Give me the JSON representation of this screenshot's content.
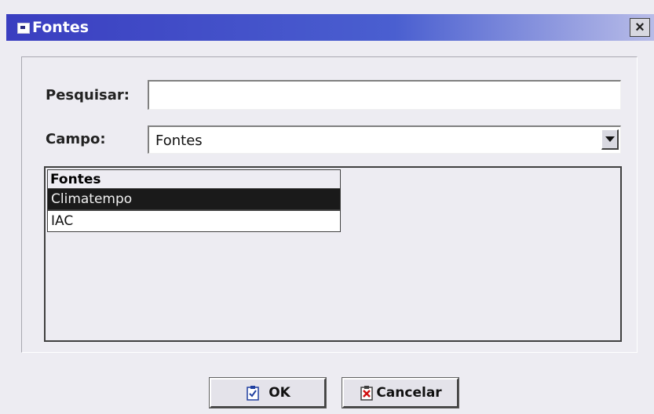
{
  "window": {
    "title": "Fontes",
    "close_label": "×"
  },
  "search": {
    "label": "Pesquisar:",
    "value": "",
    "placeholder": ""
  },
  "campo": {
    "label": "Campo:",
    "selected": "Fontes"
  },
  "list": {
    "header": "Fontes",
    "rows": [
      {
        "text": "Climatempo",
        "selected": true
      },
      {
        "text": "IAC",
        "selected": false
      }
    ]
  },
  "buttons": {
    "ok_label": "OK",
    "cancel_label": "Cancelar"
  },
  "colors": {
    "titlebar_start": "#3a3ec0",
    "titlebar_end": "#b8bce8",
    "selected_row": "#1a1a1a"
  },
  "icons": {
    "window": "window-icon",
    "ok": "clipboard-check-icon",
    "cancel": "clipboard-x-icon"
  }
}
